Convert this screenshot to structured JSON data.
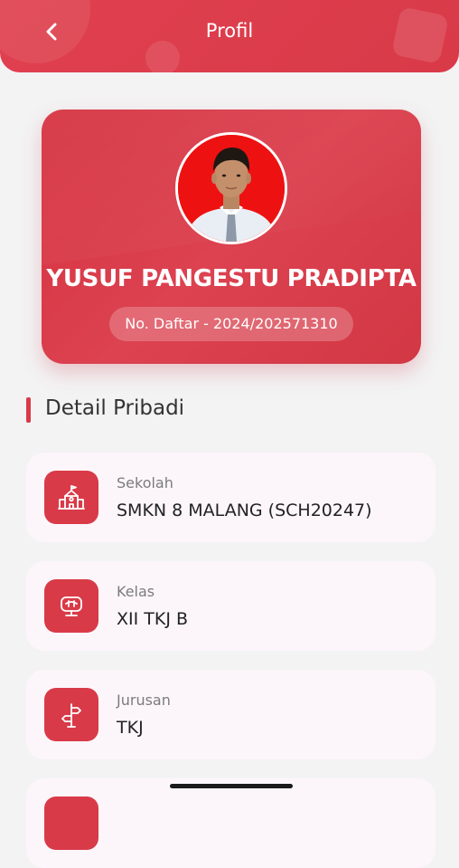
{
  "header": {
    "title": "Profil",
    "back_icon": "chevron-left-icon"
  },
  "profile": {
    "name": "YUSUF PANGESTU PRADIPTA",
    "registration": "No. Daftar - 2024/202571310"
  },
  "section": {
    "title": "Detail Pribadi"
  },
  "details": [
    {
      "label": "Sekolah",
      "value": "SMKN 8 MALANG (SCH20247)",
      "icon": "school-icon"
    },
    {
      "label": "Kelas",
      "value": "XII TKJ B",
      "icon": "classroom-icon"
    },
    {
      "label": "Jurusan",
      "value": "TKJ",
      "icon": "signpost-icon"
    }
  ],
  "colors": {
    "primary": "#D93A48",
    "background": "#F3F3F4",
    "card": "#FCF6FB"
  }
}
